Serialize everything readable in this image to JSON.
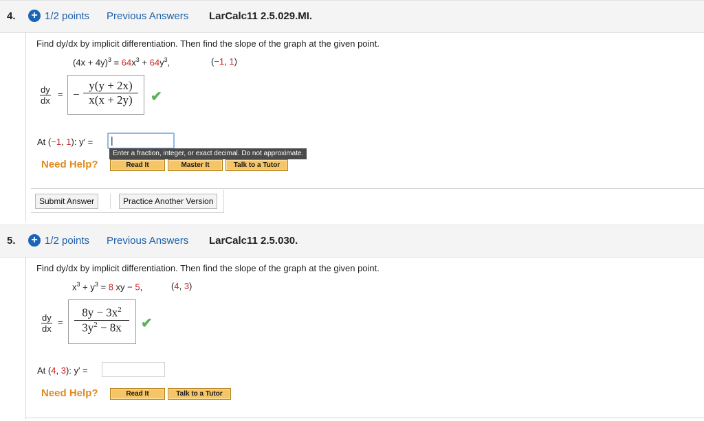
{
  "q4": {
    "number": "4.",
    "plus": "+",
    "points": "1/2 points",
    "previous": "Previous Answers",
    "ref": "LarCalc11 2.5.029.MI.",
    "instructions": "Find dy/dx by implicit differentiation. Then find the slope of the graph at the given point.",
    "eq_lhs": "(4x + 4y)",
    "eq_lhs_exp": "3",
    "eq_eq": "=",
    "eq_c1": "64",
    "eq_x": "x",
    "eq_exp1": "3",
    "eq_plus": "+",
    "eq_c2": "64",
    "eq_y": "y",
    "eq_exp2": "3",
    "eq_comma": ",",
    "point_open": "(",
    "point_x": "−1",
    "point_sep": ",",
    "point_y": "1",
    "point_close": ")",
    "dy": "dy",
    "dx": "dx",
    "equals": "=",
    "minus": "−",
    "ans_num": "y(y + 2x)",
    "ans_den": "x(x + 2y)",
    "check": "✔",
    "at_prefix": "At (",
    "at_x": "−1",
    "at_sep": ", ",
    "at_y": "1",
    "at_suffix": "): y′ =",
    "cursor": "|",
    "tooltip": "Enter a fraction, integer, or exact decimal. Do not approximate.",
    "need_help": "Need Help?",
    "read_it": "Read It",
    "master_it": "Master It",
    "talk_tutor": "Talk to a Tutor",
    "submit": "Submit Answer",
    "practice": "Practice Another Version"
  },
  "q5": {
    "number": "5.",
    "plus": "+",
    "points": "1/2 points",
    "previous": "Previous Answers",
    "ref": "LarCalc11 2.5.030.",
    "instructions": "Find dy/dx by implicit differentiation. Then find the slope of the graph at the given point.",
    "eq_x": "x",
    "eq_exp1": "3",
    "eq_plus": " + y",
    "eq_exp2": "3",
    "eq_eq": " =",
    "eq_c": "8",
    "eq_rest": " xy − ",
    "eq_c2": "5",
    "eq_comma": ",",
    "point_open": "(",
    "point_x": "4",
    "point_sep": ", ",
    "point_y": "3",
    "point_close": ")",
    "dy": "dy",
    "dx": "dx",
    "equals": "=",
    "ans_num": "8y − 3x",
    "ans_num_exp": "2",
    "ans_den": "3y",
    "ans_den_exp": "2",
    "ans_den_rest": " − 8x",
    "check": "✔",
    "at_prefix": "At (",
    "at_x": "4",
    "at_sep": ", ",
    "at_y": "3",
    "at_suffix": "): y′ =",
    "need_help": "Need Help?",
    "read_it": "Read It",
    "talk_tutor": "Talk to a Tutor"
  }
}
